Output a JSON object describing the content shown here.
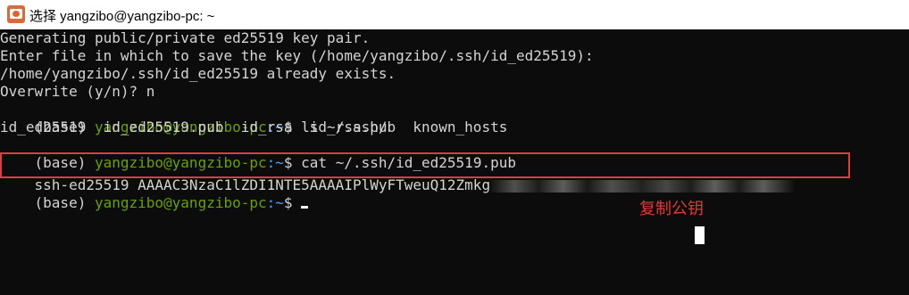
{
  "window": {
    "title": "选择 yangzibo@yangzibo-pc: ~"
  },
  "terminal": {
    "lines": [
      "Generating public/private ed25519 key pair.",
      "Enter file in which to save the key (/home/yangzibo/.ssh/id_ed25519):",
      "/home/yangzibo/.ssh/id_ed25519 already exists.",
      "Overwrite (y/n)? n"
    ],
    "prompt1": {
      "env": "(base) ",
      "user_host": "yangzibo@yangzibo-pc",
      "path": ":~",
      "symbol": "$ ",
      "command": "ls ~/.ssh/"
    },
    "ls_output": "id_ed25519  id_ed25519.pub  id_rsa  id_rsa.pub  known_hosts",
    "prompt2": {
      "env": "(base) ",
      "user_host": "yangzibo@yangzibo-pc",
      "path": ":~",
      "symbol": "$ ",
      "command": "cat ~/.ssh/id_ed25519.pub"
    },
    "public_key": "ssh-ed25519 AAAAC3NzaC1lZDI1NTE5AAAAIPlWyFTweuQ12Zmkg",
    "prompt3": {
      "env": "(base) ",
      "user_host": "yangzibo@yangzibo-pc",
      "path": ":~",
      "symbol": "$ "
    }
  },
  "annotation": {
    "text": "复制公钥",
    "color": "#e23a33"
  }
}
